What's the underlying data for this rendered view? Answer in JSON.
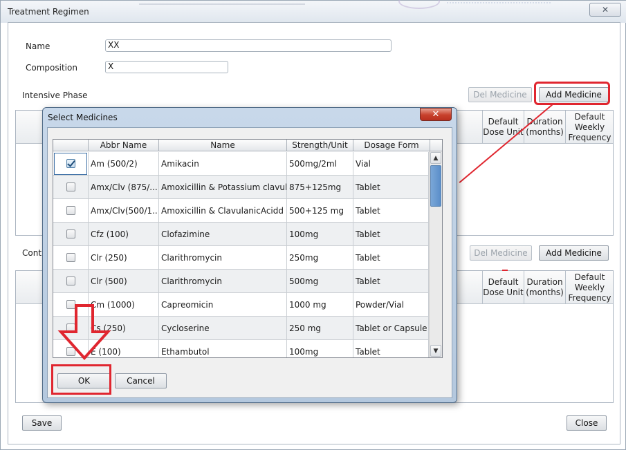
{
  "window": {
    "title": "Treatment Regimen",
    "close_glyph": "✕"
  },
  "form": {
    "name_label": "Name",
    "name_value": "XX",
    "composition_label": "Composition",
    "composition_value": "X"
  },
  "intensive": {
    "label": "Intensive Phase",
    "del_button": "Del Medicine",
    "add_button": "Add Medicine",
    "columns": [
      "Default Dose Unit",
      "Duration (months)",
      "Default Weekly Frequency"
    ]
  },
  "continuation": {
    "label": "Conti",
    "del_button": "Del Medicine",
    "add_button": "Add Medicine",
    "columns": [
      "Default Dose Unit",
      "Duration (months)",
      "Default Weekly Frequency"
    ]
  },
  "footer": {
    "save_button": "Save",
    "close_button": "Close"
  },
  "dialog": {
    "title": "Select Medicines",
    "close_glyph": "✕",
    "columns": [
      "",
      "Abbr Name",
      "Name",
      "Strength/Unit",
      "Dosage Form"
    ],
    "rows": [
      {
        "checked": true,
        "abbr": "Am (500/2)",
        "name": "Amikacin",
        "strength": "500mg/2ml",
        "form": "Vial"
      },
      {
        "checked": false,
        "abbr": "Amx/Clv (875/...",
        "name": "Amoxicillin & Potassium clavula...",
        "strength": "875+125mg",
        "form": "Tablet"
      },
      {
        "checked": false,
        "abbr": "Amx/Clv(500/1...",
        "name": "Amoxicillin & ClavulanicAcidd",
        "strength": "500+125 mg",
        "form": "Tablet"
      },
      {
        "checked": false,
        "abbr": "Cfz (100)",
        "name": "Clofazimine",
        "strength": "100mg",
        "form": "Tablet"
      },
      {
        "checked": false,
        "abbr": "Clr (250)",
        "name": "Clarithromycin",
        "strength": "250mg",
        "form": "Tablet"
      },
      {
        "checked": false,
        "abbr": "Clr (500)",
        "name": "Clarithromycin",
        "strength": "500mg",
        "form": "Tablet"
      },
      {
        "checked": false,
        "abbr": "Cm (1000)",
        "name": "Capreomicin",
        "strength": "1000 mg",
        "form": "Powder/Vial"
      },
      {
        "checked": false,
        "abbr": "Cs (250)",
        "name": "Cycloserine",
        "strength": "250 mg",
        "form": "Tablet or Capsule"
      },
      {
        "checked": false,
        "abbr": "E (100)",
        "name": "Ethambutol",
        "strength": "100mg",
        "form": "Tablet"
      }
    ],
    "ok_button": "OK",
    "cancel_button": "Cancel"
  },
  "annotation_color": "#e0262f"
}
